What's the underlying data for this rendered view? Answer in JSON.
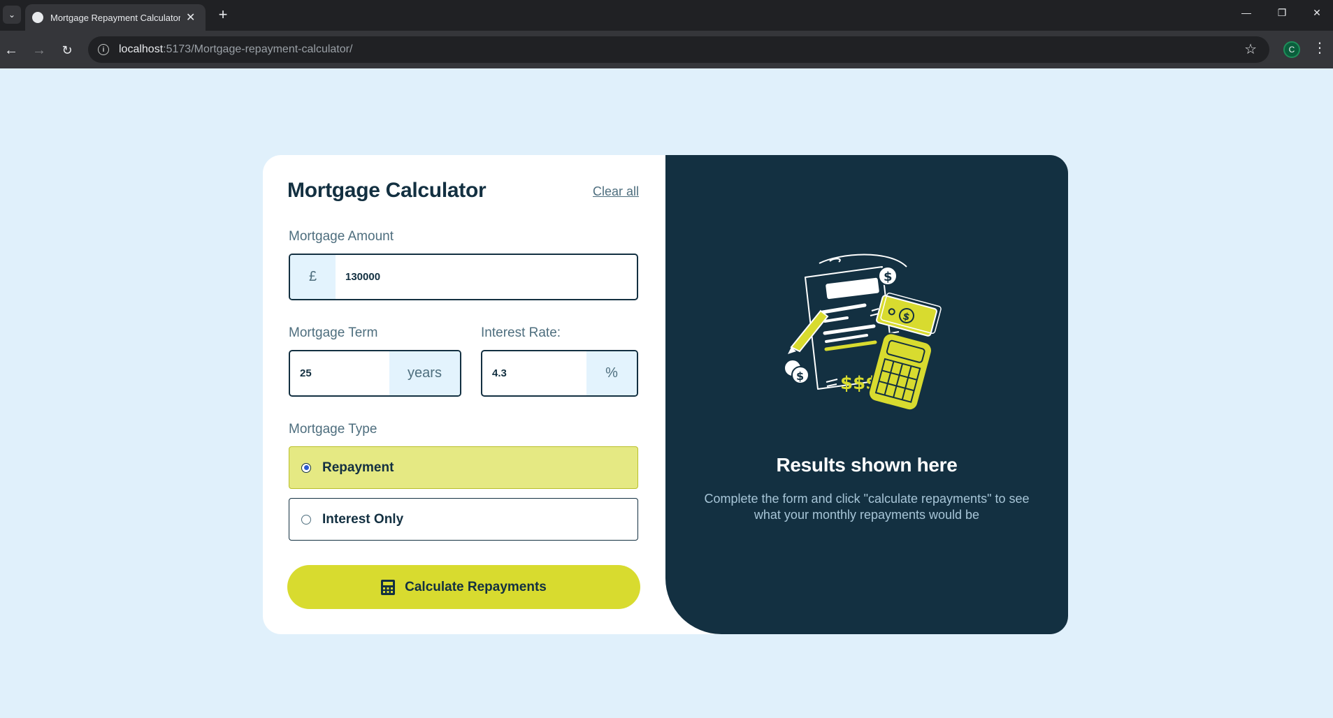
{
  "browser": {
    "tab_title": "Mortgage Repayment Calculator",
    "url_host": "localhost",
    "url_rest": ":5173/Mortgage-repayment-calculator/",
    "profile_initial": "C"
  },
  "form": {
    "title": "Mortgage Calculator",
    "clear_all": "Clear all",
    "amount": {
      "label": "Mortgage Amount",
      "prefix": "£",
      "value": "130000"
    },
    "term": {
      "label": "Mortgage Term",
      "suffix": "years",
      "value": "25"
    },
    "rate": {
      "label": "Interest Rate:",
      "suffix": "%",
      "value": "4.3"
    },
    "type": {
      "label": "Mortgage Type",
      "options": [
        {
          "label": "Repayment",
          "selected": true
        },
        {
          "label": "Interest Only",
          "selected": false
        }
      ]
    },
    "submit_label": "Calculate Repayments"
  },
  "results": {
    "title": "Results shown here",
    "description": "Complete the form and click \"calculate repayments\" to see what your monthly repayments would be"
  },
  "colors": {
    "background": "#e0f0fb",
    "dark_slate": "#133041",
    "lime": "#d8db2f",
    "lime_light": "#e5e983",
    "slate_text": "#4e6e7e"
  },
  "icons": {
    "calculator": "calculator-icon",
    "illustration": "empty-results-illustration"
  }
}
